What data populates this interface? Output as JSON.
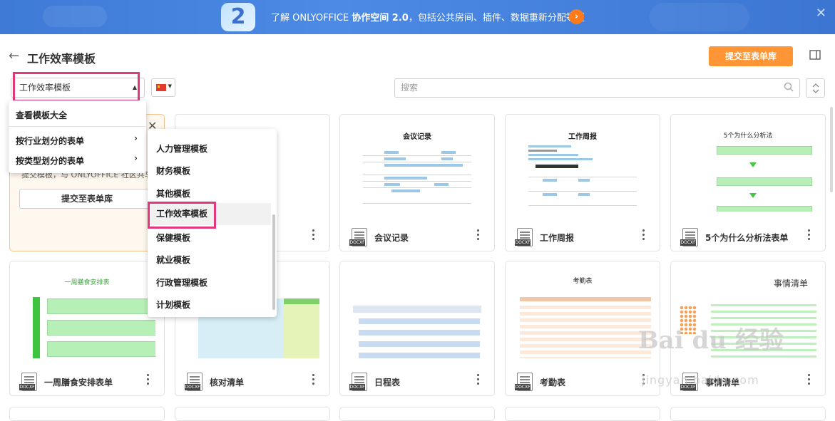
{
  "banner": {
    "badge": "2",
    "text_prefix": "了解 ONLYOFFICE ",
    "text_bold": "协作空间 2.0",
    "text_suffix": "，包括公共房间、插件、数据重新分配等更",
    "arrow": "›",
    "close": "✕"
  },
  "header": {
    "back": "←",
    "title": "工作效率模板",
    "submit_label": "提交至表单库"
  },
  "filters": {
    "category_value": "工作效率模板",
    "category_caret": "▲",
    "lang_caret": "▼",
    "search_placeholder": "搜索"
  },
  "menu_main": {
    "items": [
      {
        "label": "查看模板大全"
      },
      {
        "label": "按行业划分的表单",
        "arrow": "›"
      },
      {
        "label": "按类型划分的表单",
        "arrow": "›"
      }
    ]
  },
  "menu_sub": {
    "close": "✕",
    "items": [
      {
        "label": "人力管理模板"
      },
      {
        "label": "财务模板"
      },
      {
        "label": "其他模板"
      },
      {
        "label": "工作效率模板"
      },
      {
        "label": "保健模板"
      },
      {
        "label": "就业模板"
      },
      {
        "label": "行政管理模板"
      },
      {
        "label": "计划模板"
      }
    ]
  },
  "promo": {
    "text": "提交模板，与 ONLYOFFICE 社区共享。",
    "button": "提交至表单库"
  },
  "cards": [
    {
      "name": "会议记录",
      "thumb_title": "会议记录",
      "type": "DOCXF"
    },
    {
      "name": "工作周报",
      "thumb_title": "工作周报",
      "type": "DOCXF"
    },
    {
      "name": "5个为什么分析法表单",
      "thumb_title": "5个为什么分析法",
      "type": "DOCXF"
    },
    {
      "name": "一周膳食安排表单",
      "thumb_title": "一周膳食安排表",
      "type": "DOCXF"
    },
    {
      "name": "核对清单",
      "thumb_title": "",
      "type": "DOCXF"
    },
    {
      "name": "日程表",
      "thumb_title": "",
      "type": "DOCXF"
    },
    {
      "name": "考勤表",
      "thumb_title": "考勤表",
      "type": "DOCXF"
    },
    {
      "name": "事情清单",
      "thumb_title": "事情清单",
      "type": "DOCXF"
    }
  ],
  "colors": {
    "accent": "#ff9534",
    "banner": "#4c8ae6",
    "highlight": "#e0387a"
  },
  "watermark": {
    "main": "Bai du 经验",
    "sub": "jingyan.baidu.com"
  }
}
